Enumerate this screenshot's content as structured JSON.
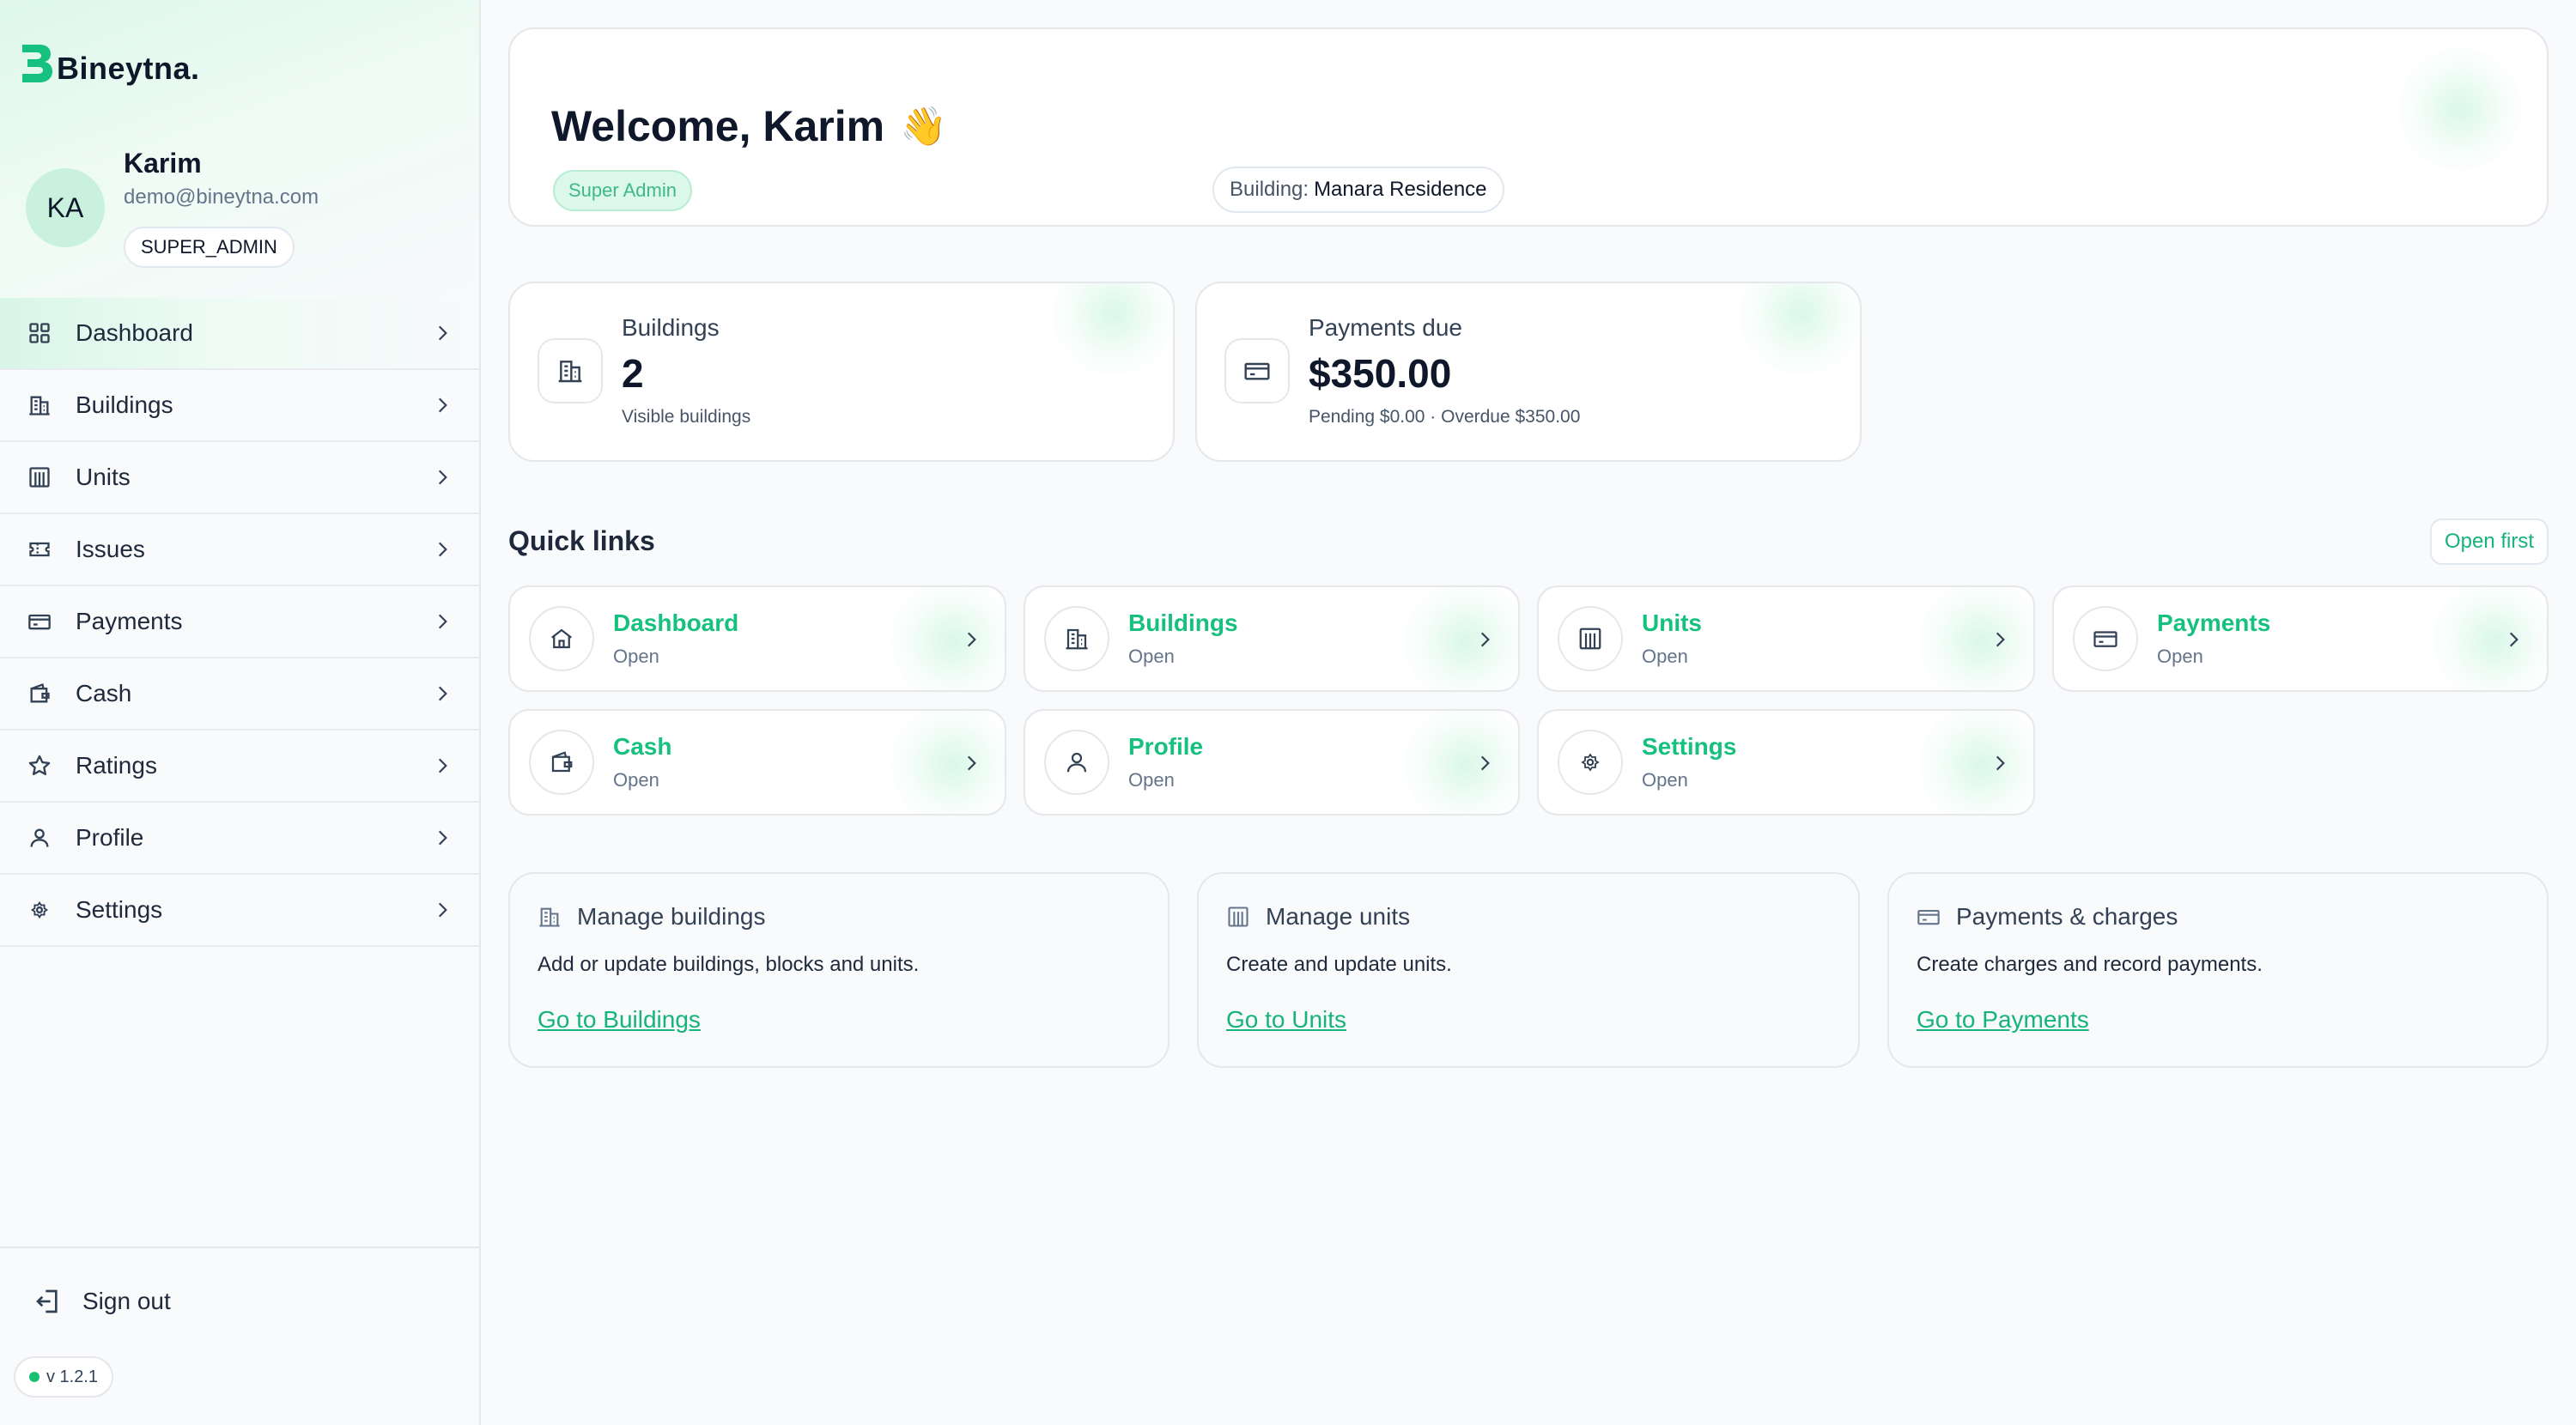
{
  "app": {
    "brand": "Bineytna.",
    "brand_color": "#16c17f"
  },
  "user": {
    "initials": "KA",
    "name": "Karim",
    "email": "demo@bineytna.com",
    "role": "SUPER_ADMIN"
  },
  "sidebar": {
    "items": [
      {
        "label": "Dashboard",
        "icon": "grid-icon",
        "active": true
      },
      {
        "label": "Buildings",
        "icon": "building-icon"
      },
      {
        "label": "Units",
        "icon": "units-icon"
      },
      {
        "label": "Issues",
        "icon": "ticket-icon"
      },
      {
        "label": "Payments",
        "icon": "card-icon"
      },
      {
        "label": "Cash",
        "icon": "wallet-icon"
      },
      {
        "label": "Ratings",
        "icon": "star-icon"
      },
      {
        "label": "Profile",
        "icon": "user-icon"
      },
      {
        "label": "Settings",
        "icon": "gear-icon"
      }
    ],
    "sign_out": "Sign out",
    "version": "v 1.2.1"
  },
  "welcome": {
    "title": "Welcome, Karim",
    "emoji": "👋",
    "role_chip": "Super Admin",
    "building_label": "Building:",
    "building_value": "Manara Residence"
  },
  "stats": [
    {
      "label": "Buildings",
      "value": "2",
      "sub": "Visible buildings",
      "icon": "building-icon"
    },
    {
      "label": "Payments due",
      "value": "$350.00",
      "sub": "Pending $0.00 · Overdue $350.00",
      "icon": "card-icon"
    }
  ],
  "quick_links": {
    "title": "Quick links",
    "open_first": "Open first",
    "items": [
      {
        "title": "Dashboard",
        "sub": "Open",
        "icon": "home-icon"
      },
      {
        "title": "Buildings",
        "sub": "Open",
        "icon": "building-icon"
      },
      {
        "title": "Units",
        "sub": "Open",
        "icon": "units-icon"
      },
      {
        "title": "Payments",
        "sub": "Open",
        "icon": "card-icon"
      },
      {
        "title": "Cash",
        "sub": "Open",
        "icon": "wallet-icon"
      },
      {
        "title": "Profile",
        "sub": "Open",
        "icon": "user-icon"
      },
      {
        "title": "Settings",
        "sub": "Open",
        "icon": "gear-icon"
      }
    ]
  },
  "manage": [
    {
      "title": "Manage buildings",
      "desc": "Add or update buildings, blocks and units.",
      "link": "Go to Buildings",
      "icon": "building-icon"
    },
    {
      "title": "Manage units",
      "desc": "Create and update units.",
      "link": "Go to Units",
      "icon": "units-icon"
    },
    {
      "title": "Payments & charges",
      "desc": "Create charges and record payments.",
      "link": "Go to Payments",
      "icon": "card-icon"
    }
  ]
}
